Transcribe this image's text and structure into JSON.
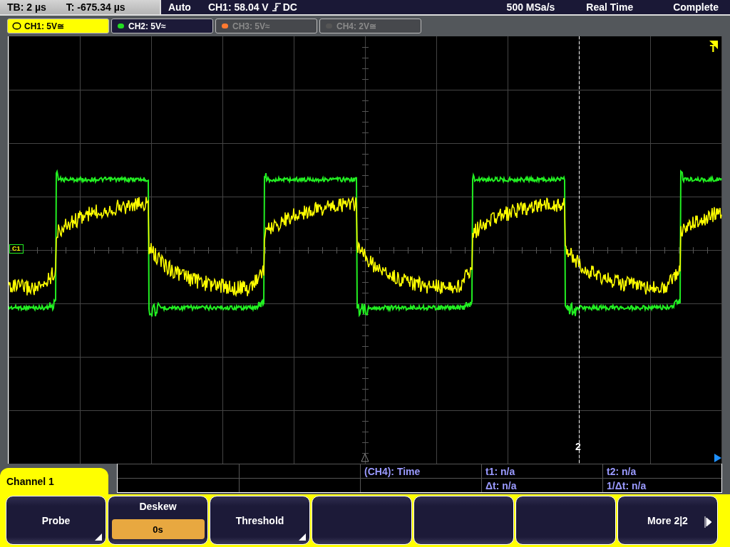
{
  "status_bar": {
    "timebase": "TB: 2 µs",
    "trigger_time": "T: -675.34 µs",
    "trigger_mode": "Auto",
    "trigger_level": "CH1: 58.04 V",
    "trigger_coupling": "DC",
    "sample_rate": "500 MSa/s",
    "acquisition_mode": "Real Time",
    "acquisition_state": "Complete"
  },
  "channel_tabs": [
    {
      "label": "CH1: 5V≅",
      "selected": true,
      "on": true,
      "color": "#ffff00"
    },
    {
      "label": "CH2: 5V≈",
      "selected": false,
      "on": true,
      "color": "#22dd22"
    },
    {
      "label": "CH3: 5V≈",
      "selected": false,
      "on": false,
      "color": "#ff7a30"
    },
    {
      "label": "CH4: 2V≅",
      "selected": false,
      "on": false,
      "color": "#555555"
    }
  ],
  "screen": {
    "channel_marker": "C1",
    "trigger_marker": "T",
    "cursor_label": "2"
  },
  "menu_title": "Channel 1",
  "measurements": {
    "source": "(CH4): Time",
    "t1": "t1: n/a",
    "t2": "t2: n/a",
    "delta_t": "Δt: n/a",
    "inverse_delta_t": "1/Δt: n/a"
  },
  "softkeys": [
    {
      "kind": "submenu",
      "label": "Probe"
    },
    {
      "kind": "value",
      "label": "Deskew",
      "value": "0s"
    },
    {
      "kind": "submenu",
      "label": "Threshold"
    },
    {
      "kind": "blank"
    },
    {
      "kind": "blank"
    },
    {
      "kind": "blank"
    },
    {
      "kind": "next",
      "label": "More 2|2"
    }
  ]
}
